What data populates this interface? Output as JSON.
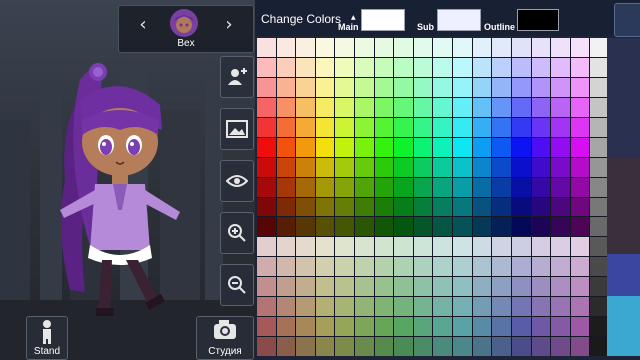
{
  "character": {
    "name": "Bex"
  },
  "buttons": {
    "stand_label": "Stand",
    "studio_label": "Студия"
  },
  "panel": {
    "title": "Change Colors",
    "main_label": "Main",
    "sub_label": "Sub",
    "outline_label": "Outline",
    "main_color": "#ffffff",
    "sub_color": "#eef0ff",
    "outline_color": "#000000"
  },
  "icons": {
    "left": "chevron-left-icon",
    "right": "chevron-right-icon",
    "add_user": "add-user-icon",
    "background": "image-icon",
    "visibility": "eye-icon",
    "zoom_in": "zoom-in-icon",
    "zoom_out": "zoom-out-icon",
    "stand": "person-icon",
    "studio": "camera-icon"
  },
  "palette": {
    "columns": 18,
    "rows": 16
  }
}
